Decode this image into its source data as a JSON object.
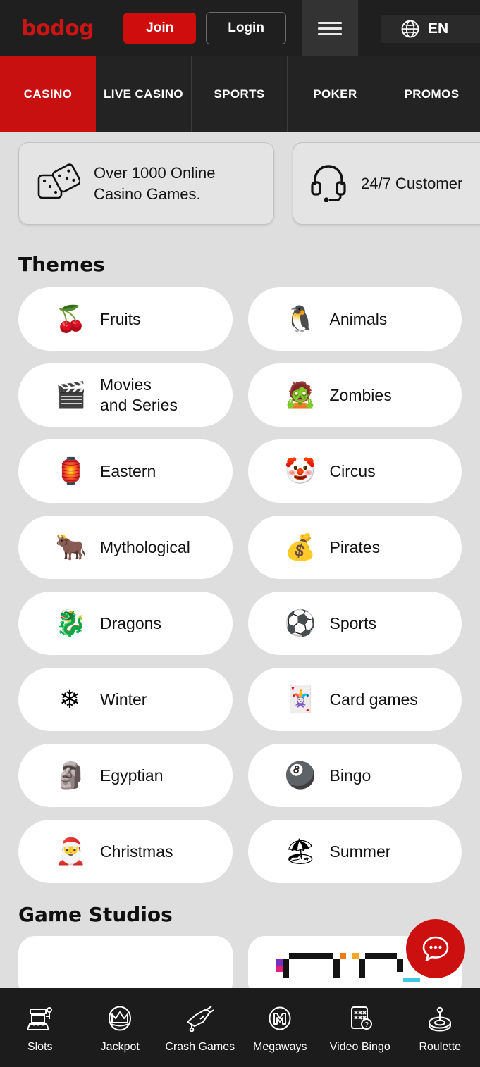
{
  "header": {
    "logo_text": "bodog",
    "join_label": "Join",
    "login_label": "Login",
    "menu_icon": "hamburger-menu-icon",
    "language_icon": "globe-icon",
    "language_label": "EN",
    "accent_red": "#cf0d0d",
    "background": "#1f1f1f"
  },
  "nav_tabs": [
    {
      "label": "CASINO",
      "active": true
    },
    {
      "label": "LIVE CASINO",
      "active": false
    },
    {
      "label": "SPORTS",
      "active": false
    },
    {
      "label": "POKER",
      "active": false
    },
    {
      "label": "PROMOS",
      "active": false
    }
  ],
  "info_cards": [
    {
      "icon": "dice-icon",
      "text": "Over 1000 Online\nCasino Games."
    },
    {
      "icon": "headset-icon",
      "text": "24/7 Customer"
    }
  ],
  "themes": {
    "title": "Themes",
    "items": [
      {
        "label": "Fruits",
        "icon": "cherries-icon",
        "emoji": "🍒"
      },
      {
        "label": "Animals",
        "icon": "penguin-icon",
        "emoji": "🐧"
      },
      {
        "label": "Movies\nand Series",
        "icon": "jurassic-park-icon",
        "emoji": "🎬"
      },
      {
        "label": "Zombies",
        "icon": "zombie-icon",
        "emoji": "🧟"
      },
      {
        "label": "Eastern",
        "icon": "eastern-icon",
        "emoji": "🏮"
      },
      {
        "label": "Circus",
        "icon": "jester-hat-icon",
        "emoji": "🤡"
      },
      {
        "label": "Mythological",
        "icon": "minotaur-icon",
        "emoji": "🐂"
      },
      {
        "label": "Pirates",
        "icon": "treasure-chest-icon",
        "emoji": "💰"
      },
      {
        "label": "Dragons",
        "icon": "dragon-icon",
        "emoji": "🐉"
      },
      {
        "label": "Sports",
        "icon": "soccer-ball-icon",
        "emoji": "⚽"
      },
      {
        "label": "Winter",
        "icon": "winter-penguin-icon",
        "emoji": "❄"
      },
      {
        "label": "Card games",
        "icon": "playing-cards-icon",
        "emoji": "🃏"
      },
      {
        "label": "Egyptian",
        "icon": "pharaoh-icon",
        "emoji": "🗿"
      },
      {
        "label": "Bingo",
        "icon": "bingo-ball-icon",
        "emoji": "🎱"
      },
      {
        "label": "Christmas",
        "icon": "stocking-icon",
        "emoji": "🎅"
      },
      {
        "label": "Summer",
        "icon": "beach-umbrella-icon",
        "emoji": "🏖"
      }
    ]
  },
  "game_studios": {
    "title": "Game Studios"
  },
  "chat": {
    "icon": "chat-bubble-icon",
    "color": "#cc1010"
  },
  "bottom_nav": [
    {
      "label": "Slots",
      "icon": "slot-machine-icon"
    },
    {
      "label": "Jackpot",
      "icon": "crown-icon"
    },
    {
      "label": "Crash Games",
      "icon": "airplane-icon"
    },
    {
      "label": "Megaways",
      "icon": "megaways-m-icon"
    },
    {
      "label": "Video Bingo",
      "icon": "bingo-card-icon"
    },
    {
      "label": "Roulette",
      "icon": "roulette-wheel-icon"
    }
  ]
}
